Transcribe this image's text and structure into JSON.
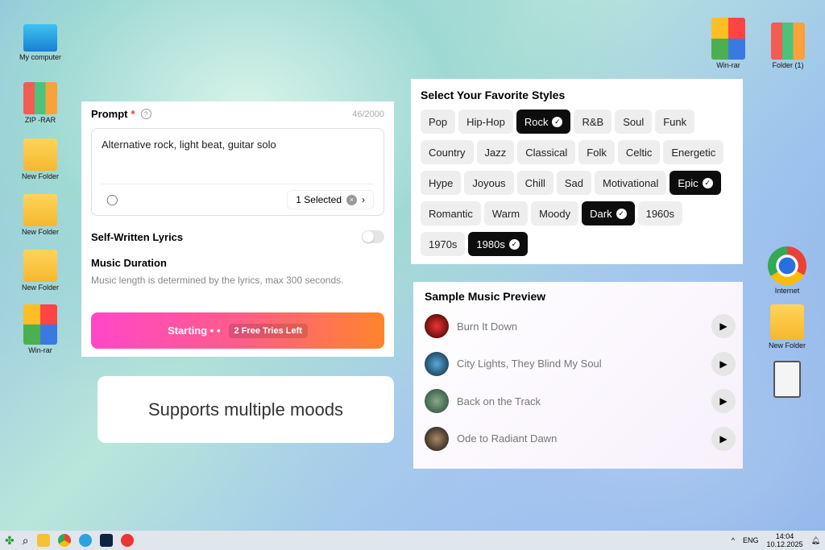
{
  "desktop": {
    "icons": [
      "My computer",
      "ZIP -RAR",
      "New Folder",
      "New Folder",
      "New Folder",
      "Win-rar",
      "Win-rar",
      "Folder (1)",
      "Internet",
      "New Folder"
    ]
  },
  "prompt": {
    "label": "Prompt",
    "required": "*",
    "counter": "46/2000",
    "value": "Alternative rock, light beat, guitar solo",
    "selected": "1 Selected",
    "lyrics_label": "Self-Written Lyrics",
    "lyrics_on": false,
    "duration_title": "Music Duration",
    "duration_desc": "Music length is determined by the lyrics, max 300 seconds.",
    "button": "Starting • •",
    "tries": "2 Free Tries Left"
  },
  "caption": "Supports multiple moods",
  "styles": {
    "title": "Select Your Favorite Styles",
    "items": [
      {
        "label": "Pop",
        "on": false
      },
      {
        "label": "Hip-Hop",
        "on": false
      },
      {
        "label": "Rock",
        "on": true
      },
      {
        "label": "R&B",
        "on": false
      },
      {
        "label": "Soul",
        "on": false
      },
      {
        "label": "Funk",
        "on": false
      },
      {
        "label": "Country",
        "on": false
      },
      {
        "label": "Jazz",
        "on": false
      },
      {
        "label": "Classical",
        "on": false
      },
      {
        "label": "Folk",
        "on": false
      },
      {
        "label": "Celtic",
        "on": false
      },
      {
        "label": "Energetic",
        "on": false
      },
      {
        "label": "Hype",
        "on": false
      },
      {
        "label": "Joyous",
        "on": false
      },
      {
        "label": "Chill",
        "on": false
      },
      {
        "label": "Sad",
        "on": false
      },
      {
        "label": "Motivational",
        "on": false
      },
      {
        "label": "Epic",
        "on": true
      },
      {
        "label": "Romantic",
        "on": false
      },
      {
        "label": "Warm",
        "on": false
      },
      {
        "label": "Moody",
        "on": false
      },
      {
        "label": "Dark",
        "on": true
      },
      {
        "label": "1960s",
        "on": false
      },
      {
        "label": "1970s",
        "on": false
      },
      {
        "label": "1980s",
        "on": true
      }
    ]
  },
  "preview": {
    "title": "Sample Music Preview",
    "songs": [
      "Burn It Down",
      "City Lights, They Blind My Soul",
      "Back on the Track",
      "Ode to Radiant Dawn"
    ]
  },
  "taskbar": {
    "lang": "ENG",
    "time": "14:04",
    "date": "10.12.2025"
  }
}
